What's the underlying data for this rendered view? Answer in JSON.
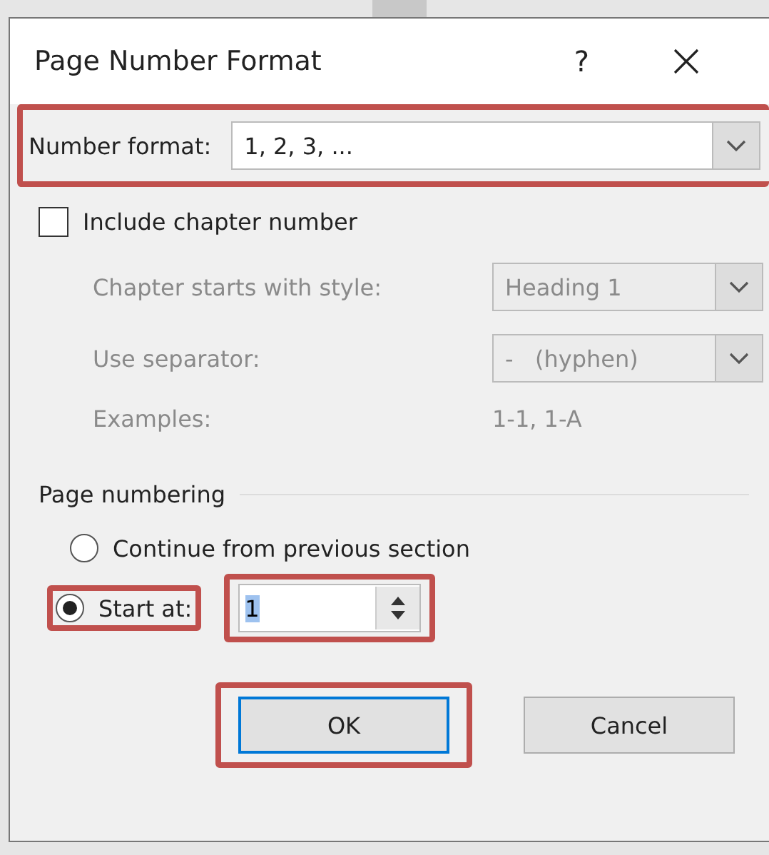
{
  "dialog": {
    "title": "Page Number Format",
    "help_button": "?"
  },
  "number_format": {
    "label": "Number format:",
    "value": "1, 2, 3, ...",
    "highlighted": true
  },
  "include_chapter": {
    "label": "Include chapter number",
    "checked": false
  },
  "chapter_options": {
    "disabled": true,
    "style": {
      "label": "Chapter starts with style:",
      "value": "Heading 1"
    },
    "separator": {
      "label": "Use separator:",
      "value": "-   (hyphen)"
    },
    "examples": {
      "label": "Examples:",
      "value": "1-1, 1-A"
    }
  },
  "page_numbering": {
    "title": "Page numbering",
    "options": [
      {
        "label": "Continue from previous section",
        "selected": false,
        "highlighted": false
      },
      {
        "label": "Start at:",
        "selected": true,
        "highlighted": true
      }
    ],
    "start_at": {
      "value": "1",
      "highlighted": true
    }
  },
  "buttons": [
    {
      "label": "OK",
      "default": true,
      "highlighted": true
    },
    {
      "label": "Cancel",
      "default": false,
      "highlighted": false
    }
  ]
}
